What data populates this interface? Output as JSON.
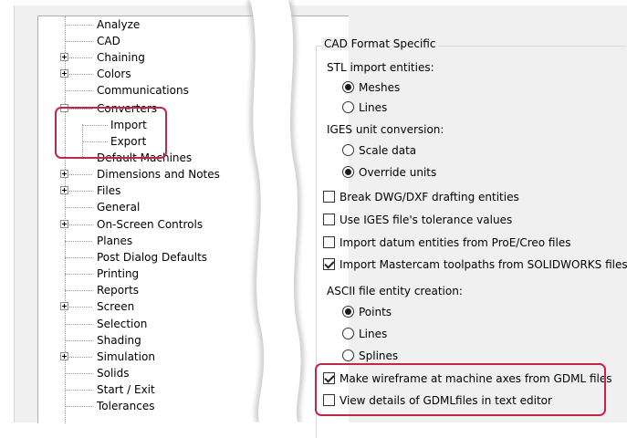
{
  "tree": {
    "items": [
      {
        "label": "Analyze"
      },
      {
        "label": "CAD"
      },
      {
        "label": "Chaining"
      },
      {
        "label": "Colors"
      },
      {
        "label": "Communications"
      },
      {
        "label": "Converters"
      },
      {
        "label": "Import"
      },
      {
        "label": "Export"
      },
      {
        "label": "Default Machines"
      },
      {
        "label": "Dimensions and Notes"
      },
      {
        "label": "Files"
      },
      {
        "label": "General"
      },
      {
        "label": "On-Screen Controls"
      },
      {
        "label": "Planes"
      },
      {
        "label": "Post Dialog Defaults"
      },
      {
        "label": "Printing"
      },
      {
        "label": "Reports"
      },
      {
        "label": "Screen"
      },
      {
        "label": "Selection"
      },
      {
        "label": "Shading"
      },
      {
        "label": "Simulation"
      },
      {
        "label": "Solids"
      },
      {
        "label": "Start / Exit"
      },
      {
        "label": "Tolerances"
      }
    ]
  },
  "panel": {
    "group_title": "CAD Format Specific",
    "stl_label": "STL import entities:",
    "stl_options": [
      {
        "label": "Meshes",
        "selected": true
      },
      {
        "label": "Lines",
        "selected": false
      }
    ],
    "iges_label": "IGES unit conversion:",
    "iges_options": [
      {
        "label": "Scale data",
        "selected": false
      },
      {
        "label": "Override units",
        "selected": true
      }
    ],
    "checkboxes": [
      {
        "label": "Break DWG/DXF drafting entities",
        "checked": false
      },
      {
        "label": "Use IGES file's tolerance values",
        "checked": false
      },
      {
        "label": "Import datum entities from ProE/Creo files",
        "checked": false
      },
      {
        "label": "Import Mastercam toolpaths from SOLIDWORKS files",
        "checked": true
      }
    ],
    "ascii_label": "ASCII file entity creation:",
    "ascii_options": [
      {
        "label": "Points",
        "selected": true
      },
      {
        "label": "Lines",
        "selected": false
      },
      {
        "label": "Splines",
        "selected": false
      }
    ],
    "gdml_checkboxes": [
      {
        "label": "Make wireframe at machine axes from GDML files",
        "checked": true
      },
      {
        "label": "View details of GDMLfiles in text editor",
        "checked": false
      }
    ]
  },
  "colors": {
    "highlight": "#c0274a",
    "background": "#f0f0f0"
  }
}
